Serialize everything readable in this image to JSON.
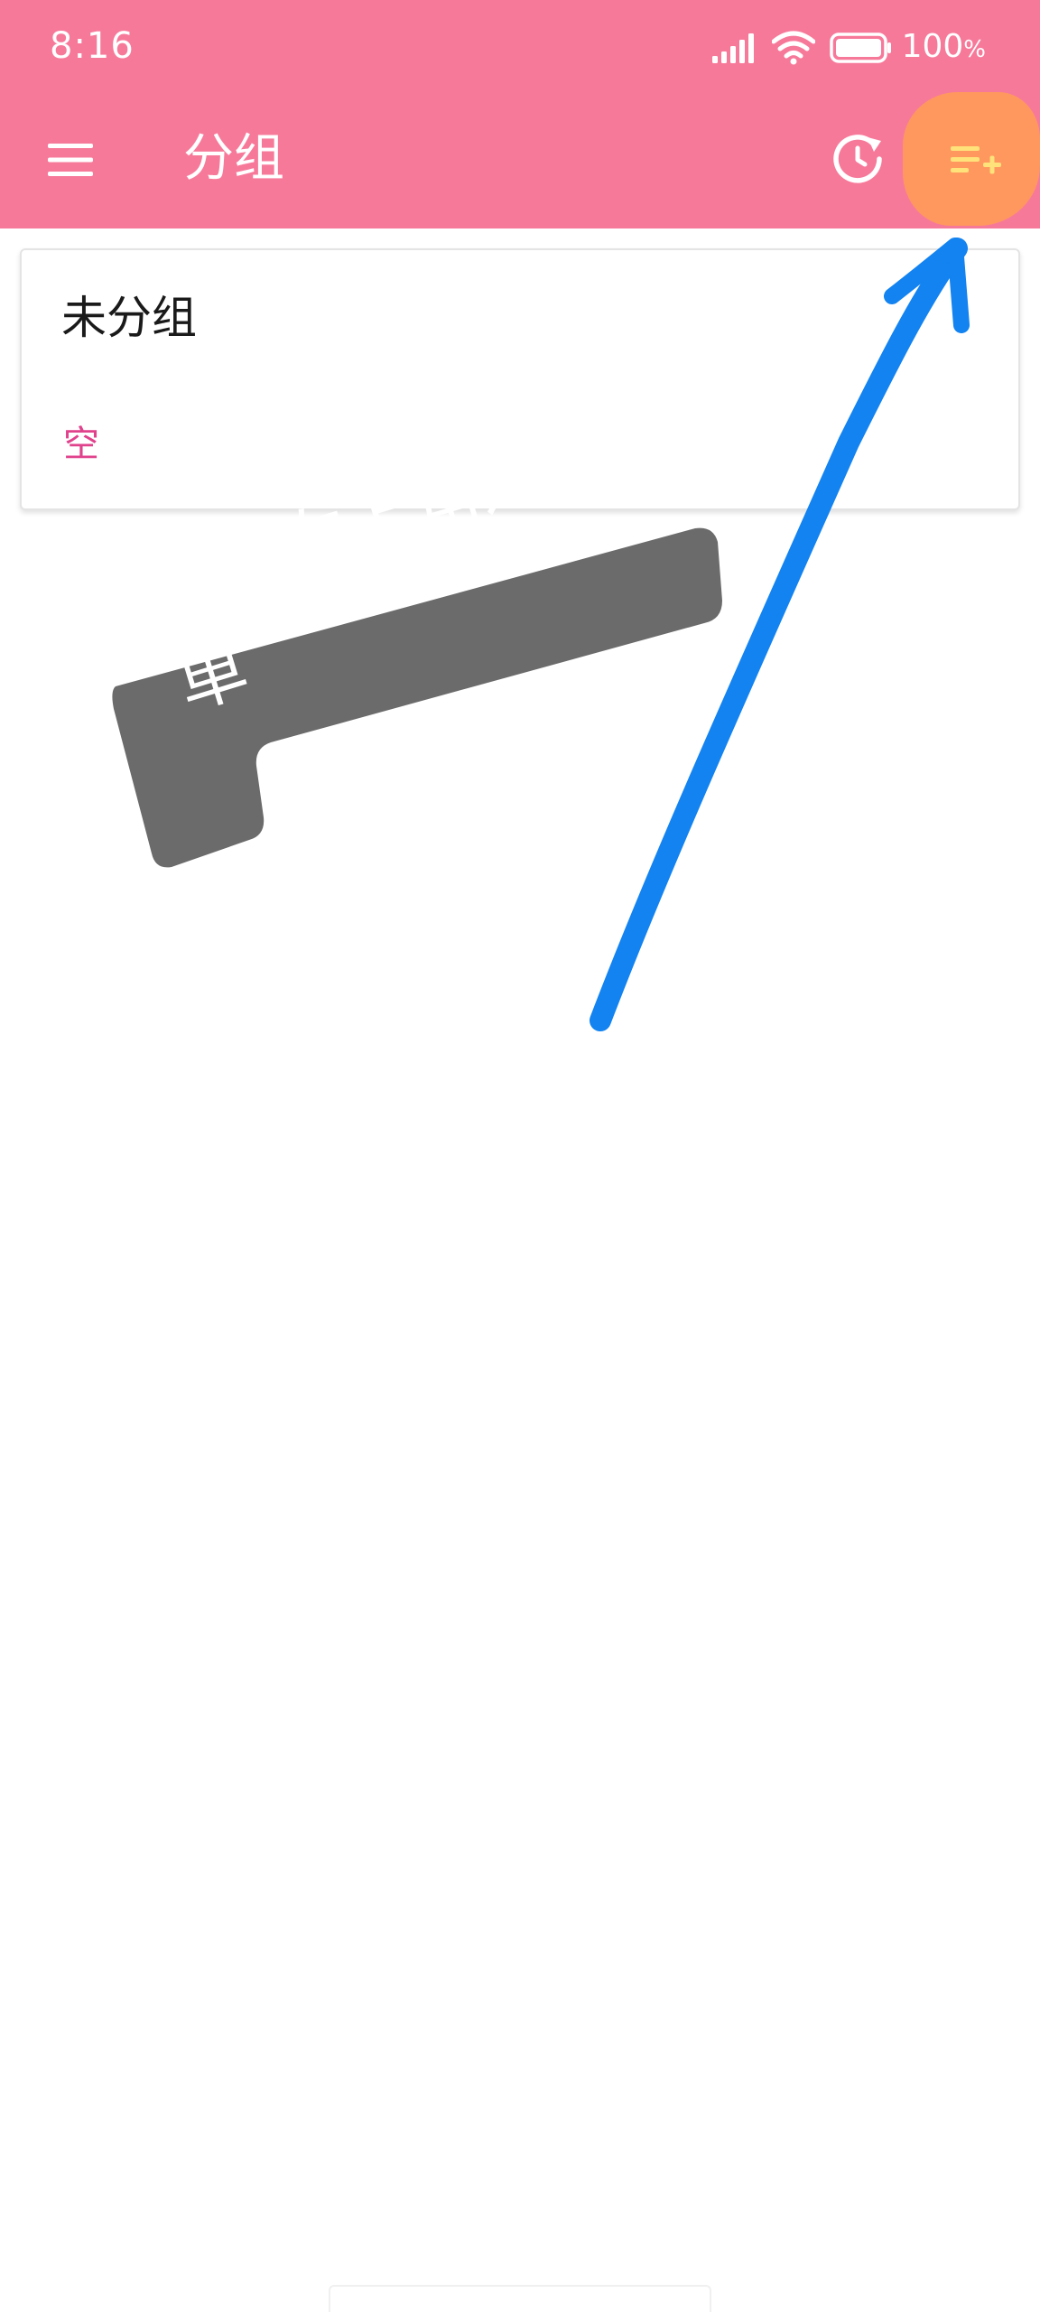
{
  "status_bar": {
    "time": "8:16",
    "battery_value": "100",
    "battery_unit": "%"
  },
  "toolbar": {
    "title": "分组",
    "background_color": "#F7799A"
  },
  "icons": {
    "menu": "hamburger-menu-icon",
    "history": "history-icon",
    "add_group": "playlist-add-icon",
    "signal": "cellular-signal-icon",
    "wifi": "wifi-icon",
    "battery": "battery-icon"
  },
  "groups": [
    {
      "name": "未分组",
      "status": "空"
    }
  ],
  "annotation": {
    "callout_line1": "点击右上角这个菜",
    "callout_line2": "单",
    "arrow_color": "#1283F0",
    "callout_color": "#6B6B6B",
    "highlight_color": "#FF9A5C"
  },
  "colors": {
    "accent_text": "#E0428C",
    "add_icon": "#FFE27A"
  }
}
